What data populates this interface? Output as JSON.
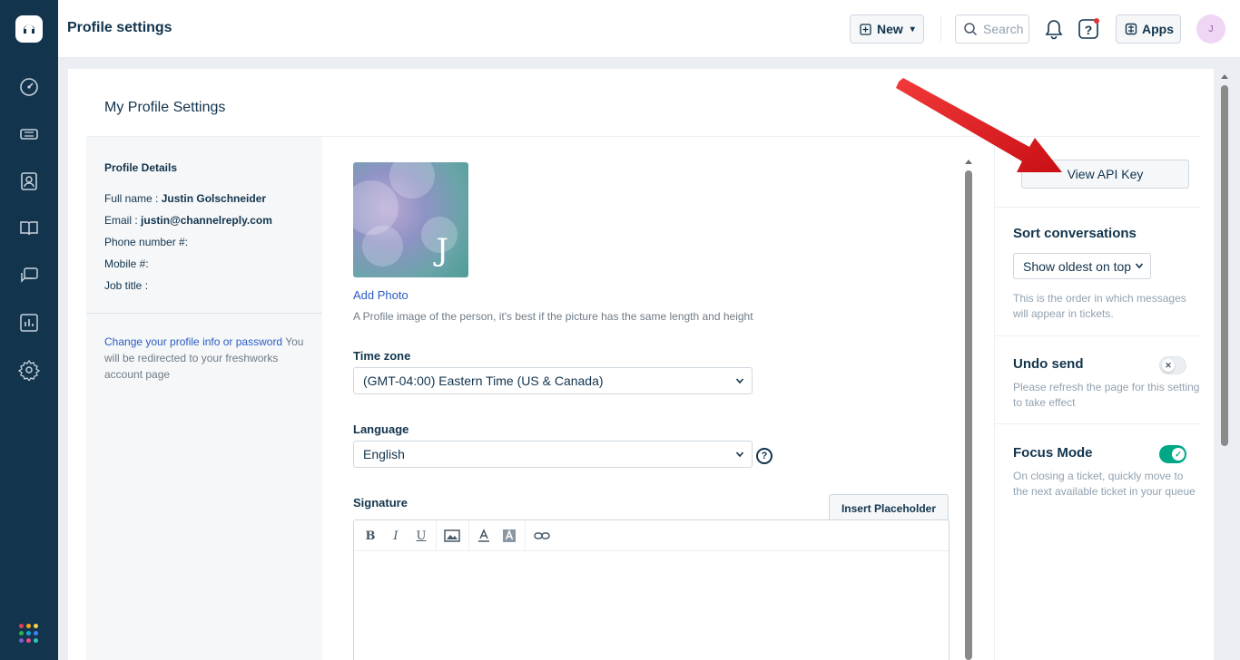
{
  "header": {
    "title": "Profile settings",
    "new_label": "New",
    "search_placeholder": "Search",
    "apps_label": "Apps",
    "avatar_initial": "J"
  },
  "rail": {
    "items": [
      "dashboard-icon",
      "tickets-icon",
      "contacts-icon",
      "solutions-icon",
      "discussions-icon",
      "reports-icon",
      "admin-icon"
    ],
    "app_dots": [
      "#e53e5a",
      "#f5a623",
      "#f7d046",
      "#2fb24c",
      "#1aa3d6",
      "#3b82f6",
      "#7c5ccf",
      "#e74c8b",
      "#2ec4b6"
    ]
  },
  "main": {
    "section_title": "My Profile Settings",
    "profile": {
      "heading": "Profile Details",
      "full_name_label": "Full name :",
      "full_name": "Justin Golschneider",
      "email_label": "Email :",
      "email": "justin@channelreply.com",
      "phone_label": "Phone number #:",
      "mobile_label": "Mobile #:",
      "job_title_label": "Job title :",
      "change_link": "Change your profile info or password",
      "change_note": "You will be redirected to your freshworks account page"
    },
    "photo": {
      "letter": "J",
      "add_label": "Add Photo",
      "hint": "A Profile image of the person, it's best if the picture has the same length and height"
    },
    "timezone": {
      "label": "Time zone",
      "value": "(GMT-04:00) Eastern Time (US & Canada)"
    },
    "language": {
      "label": "Language",
      "value": "English"
    },
    "signature": {
      "label": "Signature",
      "insert_placeholder": "Insert Placeholder",
      "toolbar": [
        "B",
        "I",
        "U"
      ]
    }
  },
  "side": {
    "api_key_button": "View API Key",
    "sort": {
      "title": "Sort conversations",
      "value": "Show oldest on top",
      "desc": "This is the order in which messages will appear in tickets."
    },
    "undo": {
      "title": "Undo send",
      "desc": "Please refresh the page for this setting to take effect",
      "enabled": false
    },
    "focus": {
      "title": "Focus Mode",
      "desc": "On closing a ticket, quickly move to the next available ticket in your queue",
      "enabled": true
    },
    "colors": {
      "toggle_on": "#00a886",
      "toggle_off": "#ebeff3",
      "annotation_arrow": "#e3141b"
    }
  }
}
